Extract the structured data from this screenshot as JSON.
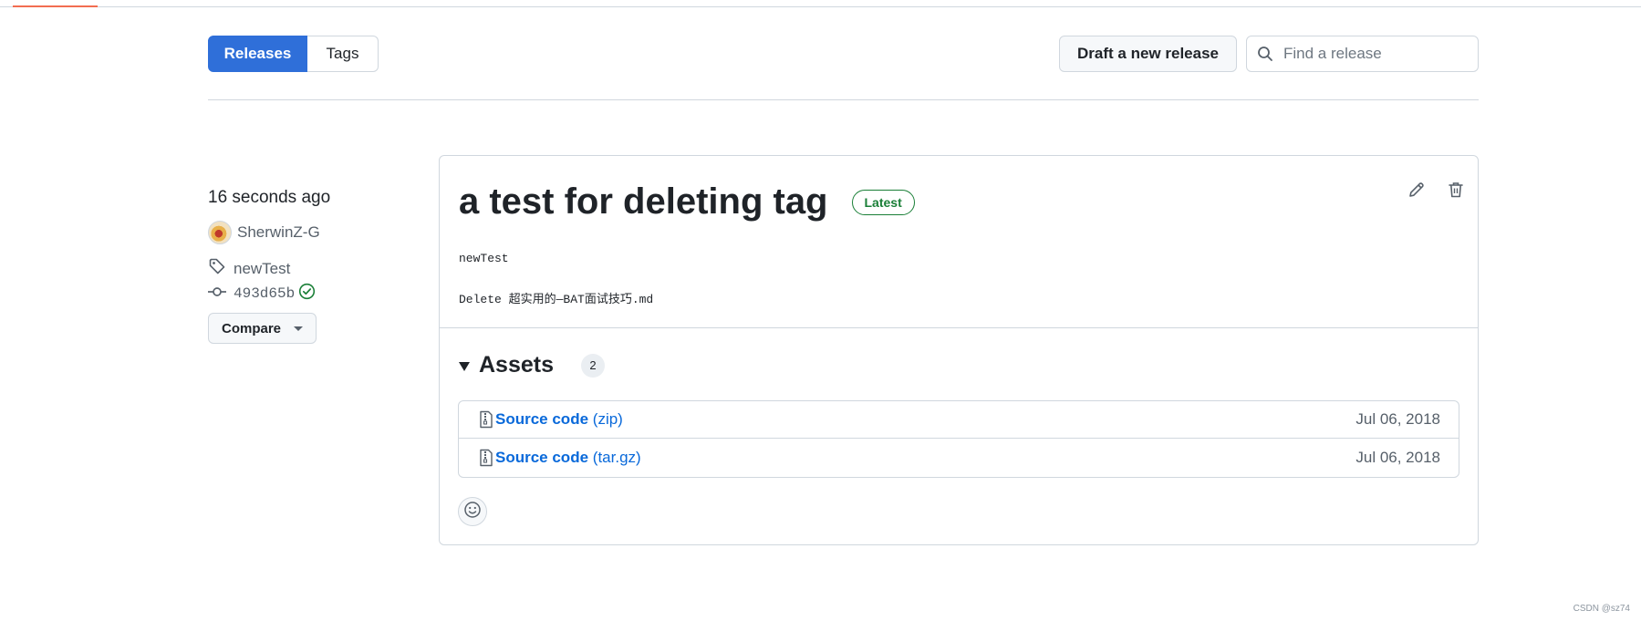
{
  "subnav": {
    "releases_label": "Releases",
    "tags_label": "Tags"
  },
  "toolbar": {
    "draft_label": "Draft a new release",
    "search_placeholder": "Find a release"
  },
  "release": {
    "time_ago": "16 seconds ago",
    "author": "SherwinZ-G",
    "tag": "newTest",
    "commit": "493d65b",
    "compare_label": "Compare",
    "title": "a test for deleting tag",
    "badge": "Latest",
    "body": [
      "newTest",
      "Delete 超实用的—BAT面试技巧.md"
    ],
    "assets": {
      "label": "Assets",
      "count": "2",
      "items": [
        {
          "name": "Source code",
          "format": "(zip)",
          "date": "Jul 06, 2018"
        },
        {
          "name": "Source code",
          "format": "(tar.gz)",
          "date": "Jul 06, 2018"
        }
      ]
    }
  },
  "watermark": "CSDN @sz74",
  "colors": {
    "accent": "#2f6fd9",
    "link": "#0969da",
    "success": "#1a7f37",
    "border": "#d0d7de"
  },
  "icons": [
    "search-icon",
    "tag-icon",
    "commit-icon",
    "check-circle-icon",
    "caret-down-icon",
    "pencil-icon",
    "trash-icon",
    "triangle-down-icon",
    "file-zip-icon",
    "smiley-icon"
  ]
}
